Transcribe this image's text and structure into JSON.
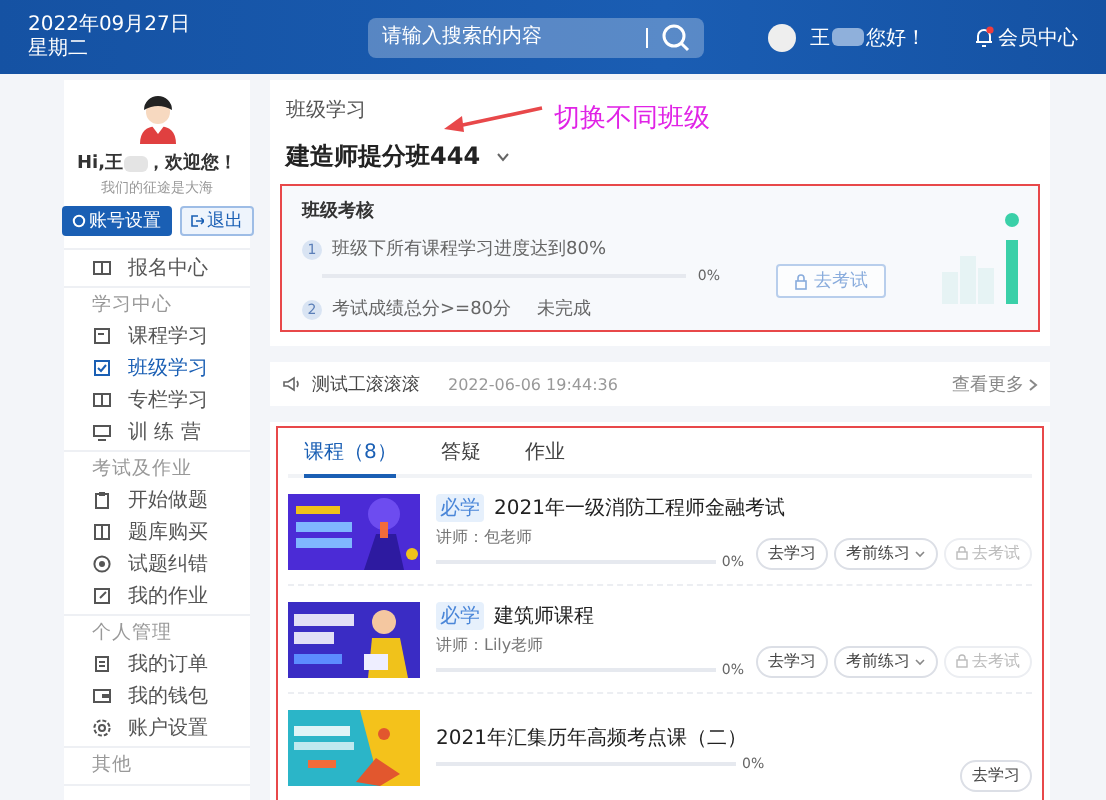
{
  "header": {
    "date": "2022年09月27日",
    "weekday": "星期二",
    "search": {
      "placeholder": "请输入搜索的内容"
    },
    "greeting_name": "王",
    "greeting_suffix": "您好！",
    "member_link": "会员中心",
    "notification_dot": true
  },
  "sidebar": {
    "greeting_prefix": "Hi,王",
    "greeting_suffix": "，欢迎您！",
    "motto": "我们的征途是大海",
    "buttons": [
      {
        "label": "账号设置",
        "kind": "primary"
      },
      {
        "label": "退出",
        "kind": "outline"
      }
    ],
    "sections": [
      {
        "items": [
          {
            "label": "报名中心",
            "selected": false
          }
        ]
      },
      {
        "title": "学习中心",
        "items": [
          {
            "label": "课程学习",
            "selected": false
          },
          {
            "label": "班级学习",
            "selected": true
          },
          {
            "label": "专栏学习",
            "selected": false
          },
          {
            "label": "训 练 营",
            "selected": false
          }
        ]
      },
      {
        "title": "考试及作业",
        "items": [
          {
            "label": "开始做题",
            "selected": false
          },
          {
            "label": "题库购买",
            "selected": false
          },
          {
            "label": "试题纠错",
            "selected": false
          },
          {
            "label": "我的作业",
            "selected": false
          }
        ]
      },
      {
        "title": "个人管理",
        "items": [
          {
            "label": "我的订单",
            "selected": false
          },
          {
            "label": "我的钱包",
            "selected": false
          },
          {
            "label": "账户设置",
            "selected": false
          }
        ]
      },
      {
        "title": "其他"
      }
    ]
  },
  "class_card": {
    "section_title": "班级学习",
    "class_name": "建造师提分班444",
    "annotation": {
      "text": "切换不同班级"
    },
    "assessment": {
      "title": "班级考核",
      "highlighted": true,
      "steps": [
        {
          "number": "1",
          "text": "班级下所有课程学习进度达到80%",
          "level": 0,
          "reading": "0%"
        },
        {
          "number": "2",
          "text": "考试成绩总分>=80分",
          "status": "未完成"
        }
      ],
      "exam_button": {
        "label": "去考试",
        "disabled": true
      }
    }
  },
  "notice": {
    "title": "测试工滚滚滚",
    "time": "2022-06-06 19:44:36",
    "more_link": "查看更多"
  },
  "course_panel": {
    "highlighted": true,
    "tabs": [
      {
        "label": "课程（8）",
        "selected": true
      },
      {
        "label": "答疑",
        "selected": false
      },
      {
        "label": "作业",
        "selected": false
      }
    ],
    "courses": [
      {
        "tag": "必学",
        "title": "2021年一级消防工程师金融考试",
        "teacher": "讲师：包老师",
        "level": 0,
        "reading": "0%",
        "buttons": [
          {
            "kind": "study",
            "label": "去学习",
            "disabled": false
          },
          {
            "kind": "practice",
            "label": "考前练习",
            "disabled": false
          },
          {
            "kind": "exam",
            "label": "去考试",
            "disabled": true
          }
        ]
      },
      {
        "tag": "必学",
        "title": "建筑师课程",
        "teacher": "讲师：Lily老师",
        "level": 0,
        "reading": "0%",
        "buttons": [
          {
            "kind": "study",
            "label": "去学习",
            "disabled": false
          },
          {
            "kind": "practice",
            "label": "考前练习",
            "disabled": false
          },
          {
            "kind": "exam",
            "label": "去考试",
            "disabled": true
          }
        ]
      },
      {
        "title": "2021年汇集历年高频考点课（二）",
        "level": 0,
        "reading": "0%",
        "buttons": [
          {
            "kind": "study",
            "label": "去学习",
            "disabled": false
          }
        ]
      }
    ]
  }
}
